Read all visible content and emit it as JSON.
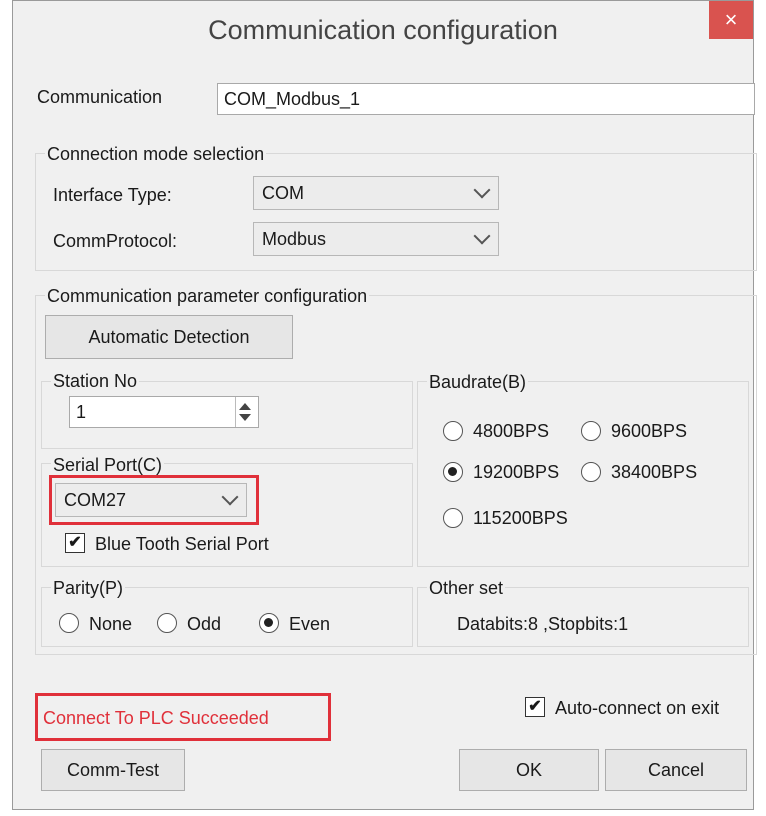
{
  "window": {
    "title": "Communication configuration",
    "close_glyph": "×"
  },
  "communication": {
    "label": "Communication",
    "value": "COM_Modbus_1"
  },
  "connection_mode": {
    "title": "Connection mode selection",
    "interface_type": {
      "label": "Interface Type:",
      "value": "COM"
    },
    "comm_protocol": {
      "label": "CommProtocol:",
      "value": "Modbus"
    }
  },
  "comm_params": {
    "title": "Communication parameter configuration",
    "auto_detect_label": "Automatic Detection",
    "station": {
      "title": "Station No",
      "value": "1"
    },
    "baudrate": {
      "title": "Baudrate(B)",
      "options": [
        "4800BPS",
        "9600BPS",
        "19200BPS",
        "38400BPS",
        "115200BPS"
      ],
      "selected": "19200BPS"
    },
    "serial_port": {
      "title": "Serial Port(C)",
      "value": "COM27",
      "bluetooth_label": "Blue Tooth Serial Port",
      "bluetooth_checked": true
    },
    "parity": {
      "title": "Parity(P)",
      "options": [
        "None",
        "Odd",
        "Even"
      ],
      "selected": "Even"
    },
    "other": {
      "title": "Other set",
      "text": "Databits:8 ,Stopbits:1"
    }
  },
  "status": {
    "text": "Connect To PLC Succeeded",
    "color": "#e0303a"
  },
  "auto_connect": {
    "label": "Auto-connect on exit",
    "checked": true
  },
  "buttons": {
    "comm_test": "Comm-Test",
    "ok": "OK",
    "cancel": "Cancel"
  },
  "colors": {
    "highlight_red": "#e0303a",
    "close_red": "#d9534f"
  }
}
